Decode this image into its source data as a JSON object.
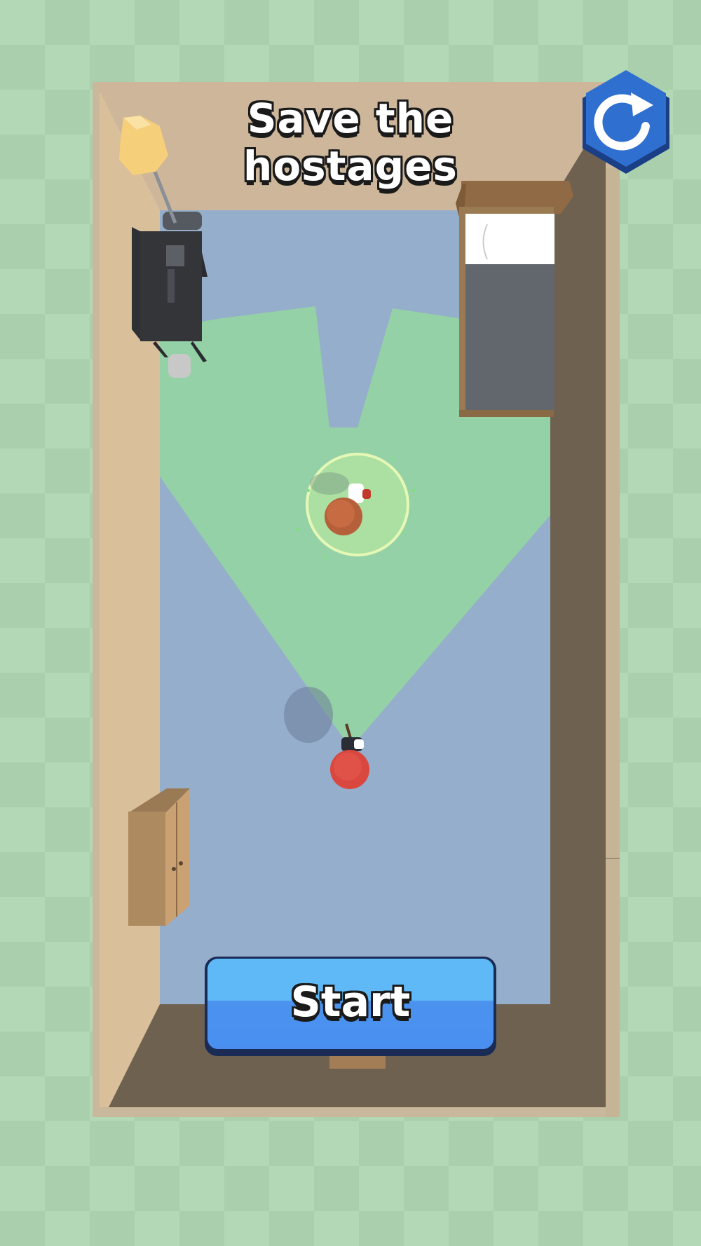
{
  "hud": {
    "objective_title": "Save the hostages",
    "restart_icon": "restart-icon",
    "start_label": "Start"
  },
  "colors": {
    "grass_light": "#b3d8b5",
    "grass_dark": "#aacfad",
    "floor": "#95aecb",
    "vision_cone": "#93d3a3",
    "wall_light": "#d6bc96",
    "wall_dark": "#6f6150",
    "button_blue": "#4a8ff0",
    "restart_blue": "#2f6fd0"
  }
}
